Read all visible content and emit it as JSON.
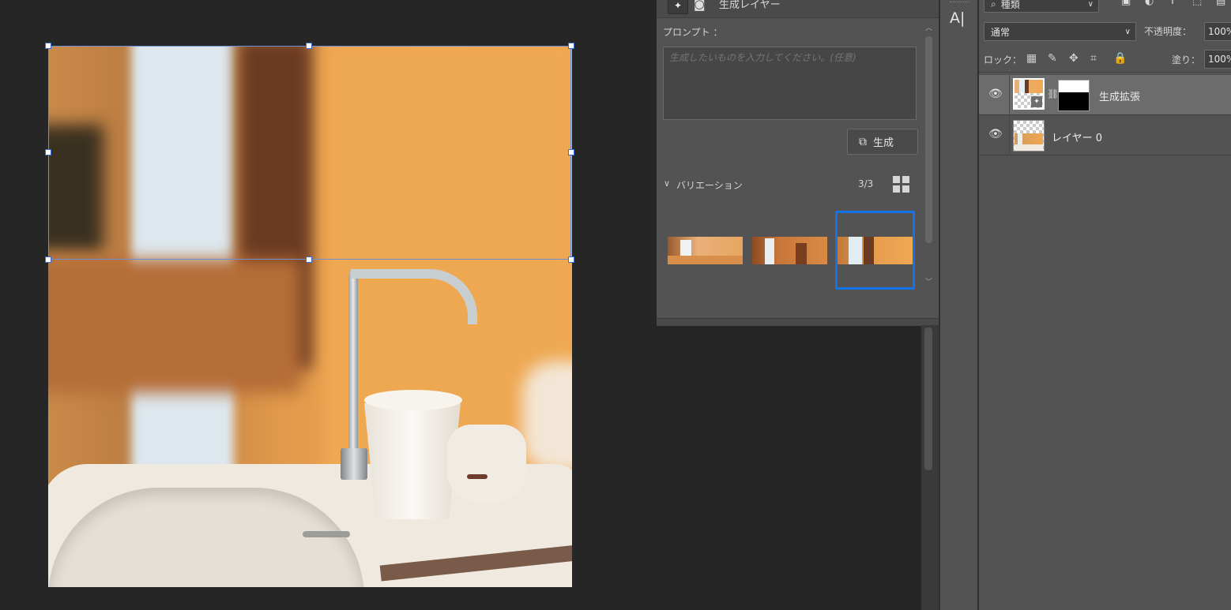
{
  "generative_panel": {
    "header_title": "生成レイヤー",
    "prompt_label": "プロンプト ：",
    "prompt_placeholder": "生成したいものを入力してください。(任意)",
    "generate_label": "生成",
    "variations_label": "バリエーション",
    "variations_count": "3/3",
    "variation_thumbs": [
      "variation-1",
      "variation-2",
      "variation-3"
    ],
    "selected_variation_index": 3
  },
  "tool_strip": {
    "character_icon_glyph": "A|"
  },
  "layers_panel": {
    "filter_kind": "種類",
    "blend_mode": "通常",
    "opacity_label": "不透明度：",
    "opacity_value": "100%",
    "lock_label": "ロック：",
    "fill_label": "塗り：",
    "fill_value": "100%",
    "layers": [
      {
        "name": "生成拡張",
        "visible": true,
        "selected": true,
        "has_mask": true
      },
      {
        "name": "レイヤー 0",
        "visible": true,
        "selected": false,
        "has_mask": false
      }
    ]
  },
  "colors": {
    "selection_accent": "#1473e6",
    "panel_bg": "#535353",
    "canvas_bg": "#262626"
  }
}
